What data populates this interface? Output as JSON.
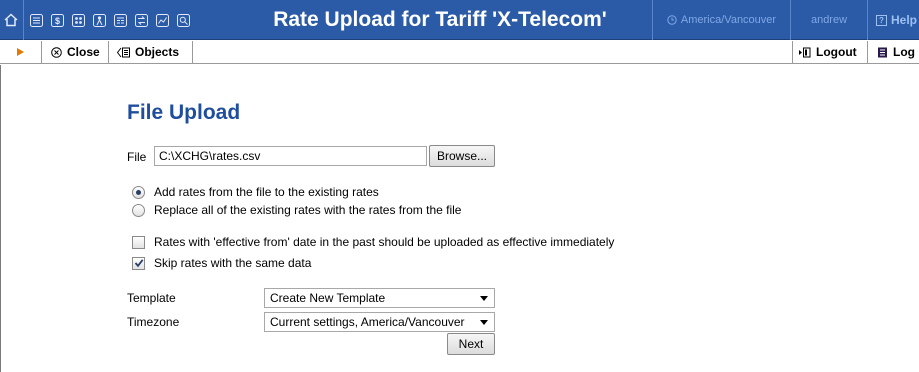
{
  "header": {
    "title": "Rate Upload for Tariff 'X-Telecom'",
    "timezone": "America/Vancouver",
    "user": "andrew",
    "help_label": "Help",
    "nav_icons": [
      "home-icon",
      "list-icon",
      "dollar-icon",
      "grid-icon",
      "person-icon",
      "calendar-icon",
      "transfer-icon",
      "chart-icon",
      "search-icon"
    ]
  },
  "toolbar": {
    "close_label": "Close",
    "objects_label": "Objects",
    "logout_label": "Logout",
    "log_label": "Log"
  },
  "form": {
    "heading": "File Upload",
    "file_label": "File",
    "file_value": "C:\\XCHG\\rates.csv",
    "browse_label": "Browse...",
    "radio_add": "Add rates from the file to the existing rates",
    "radio_replace": "Replace all of the existing rates with the rates from the file",
    "selected_radio": "add",
    "check_effective": "Rates with 'effective from' date in the past should be uploaded as effective immediately",
    "check_effective_checked": false,
    "check_skip": "Skip rates with the same data",
    "check_skip_checked": true,
    "template_label": "Template",
    "template_value": "Create New Template",
    "timezone_label": "Timezone",
    "timezone_value": "Current settings, America/Vancouver",
    "next_label": "Next"
  },
  "colors": {
    "header_bg": "#2b5aa6",
    "heading": "#1f4f9c",
    "accent_arrow": "#e07b00"
  }
}
